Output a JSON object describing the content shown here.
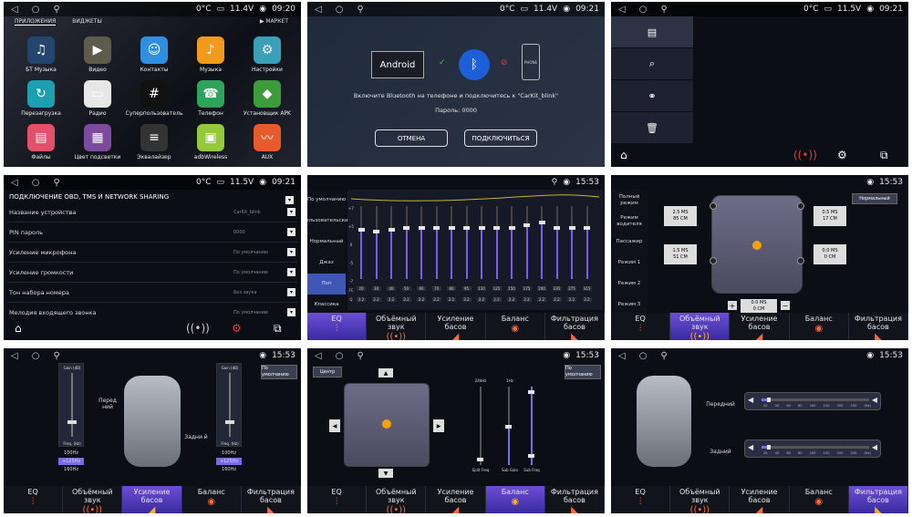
{
  "status": {
    "p1": {
      "temp": "0°C",
      "volt": "11.4V",
      "time": "09:20"
    },
    "p2": {
      "temp": "0°C",
      "volt": "11.4V",
      "time": "09:21"
    },
    "p3": {
      "temp": "0°C",
      "volt": "11.5V",
      "time": "09:21"
    },
    "p4": {
      "temp": "0°C",
      "volt": "11.5V",
      "time": "09:21"
    },
    "eq_time": "15:53"
  },
  "home": {
    "tab_apps": "ПРИЛОЖЕНИЯ",
    "tab_widgets": "ВИДЖЕТЫ",
    "market": "МАРКЕТ",
    "apps": [
      {
        "label": "БТ Музыка",
        "icon": "bluetooth-music-icon",
        "color": "#24466e",
        "glyph": "♫"
      },
      {
        "label": "Видео",
        "icon": "video-icon",
        "color": "#5d5c4c",
        "glyph": "▶"
      },
      {
        "label": "Контакты",
        "icon": "contacts-icon",
        "color": "#2f8fe0",
        "glyph": "☺"
      },
      {
        "label": "Музыка",
        "icon": "music-icon",
        "color": "#f29a1c",
        "glyph": "♪"
      },
      {
        "label": "Настройки",
        "icon": "settings-icon",
        "color": "#3aa0b8",
        "glyph": "⚙"
      },
      {
        "label": "Перезагрузка",
        "icon": "reload-icon",
        "color": "#1c9fb0",
        "glyph": "↻"
      },
      {
        "label": "Радио",
        "icon": "radio-icon",
        "color": "#e7e7e7",
        "glyph": "▭"
      },
      {
        "label": "Суперпользователь",
        "icon": "superuser-icon",
        "color": "#111111",
        "glyph": "#"
      },
      {
        "label": "Телефон",
        "icon": "phone-icon",
        "color": "#2ea35a",
        "glyph": "☎"
      },
      {
        "label": "Установщик APK",
        "icon": "apk-installer-icon",
        "color": "#3c9b3a",
        "glyph": "◆"
      },
      {
        "label": "Файлы",
        "icon": "files-icon",
        "color": "#e4506a",
        "glyph": "▤"
      },
      {
        "label": "Цвет подсветки",
        "icon": "backlight-color-icon",
        "color": "#7d4b9e",
        "glyph": "▦"
      },
      {
        "label": "Эквалайзер",
        "icon": "equalizer-icon",
        "color": "#333333",
        "glyph": "≡"
      },
      {
        "label": "adbWireless",
        "icon": "adb-wireless-icon",
        "color": "#93c93b",
        "glyph": "▣"
      },
      {
        "label": "AUX",
        "icon": "aux-icon",
        "color": "#e65a2b",
        "glyph": "〰"
      }
    ]
  },
  "bt": {
    "android": "Android",
    "phone": "PHONE",
    "message": "Включите Bluetooth на телефоне и подключитесь к \"CarKit_blink\"",
    "password": "Пароль: 0000",
    "cancel": "ОТМЕНА",
    "connect": "ПОДКЛЮЧИТЬСЯ"
  },
  "obd": {
    "title": "ПОДКЛЮЧЕНИЕ OBD, TMS И NETWORK SHARING",
    "rows": [
      {
        "label": "Название устройства",
        "value": "CarKit_blink"
      },
      {
        "label": "PIN пароль",
        "value": "0000"
      },
      {
        "label": "Усиление микрофона",
        "value": "По умолчанию"
      },
      {
        "label": "Усиление громкости",
        "value": "По умолчанию"
      },
      {
        "label": "Тон набора номера",
        "value": "Без звука"
      },
      {
        "label": "Мелодия входящего звонка",
        "value": "По умолчанию"
      }
    ]
  },
  "eq": {
    "presets": [
      "По умолчанию",
      "Пользовательские",
      "Нормальный",
      "Джаз",
      "Поп",
      "Классика",
      "Рок"
    ],
    "active_preset": "Поп",
    "bands": [
      "20",
      "30",
      "40",
      "50",
      "60",
      "70",
      "80",
      "95",
      "110",
      "125",
      "150",
      "175",
      "200",
      "235",
      "275",
      "315"
    ],
    "levels": [
      0.35,
      0.33,
      0.35,
      0.38,
      0.38,
      0.38,
      0.38,
      0.38,
      0.38,
      0.38,
      0.38,
      0.41,
      0.45,
      0.38,
      0.38,
      0.38
    ],
    "q": [
      "2.2",
      "2.2",
      "2.2",
      "2.2",
      "2.2",
      "2.2",
      "2.2",
      "2.2",
      "2.2",
      "2.2",
      "2.2",
      "2.2",
      "2.2",
      "2.2",
      "2.2",
      "2.2"
    ],
    "q_label": "Q",
    "fc_label": "FC",
    "axis": [
      "+7",
      "+5",
      "0",
      "-5",
      "-7"
    ]
  },
  "tabs": [
    "EQ",
    "Объёмный звук",
    "Усиление басов",
    "Баланс",
    "Фильтрация басов"
  ],
  "surround": {
    "modes": [
      "Полный режим",
      "Режим водителя",
      "Пассажир",
      "Режим 1",
      "Режим 2",
      "Режим 3"
    ],
    "normal": "Нормальный",
    "fl": [
      "2.5 MS",
      "85 CM"
    ],
    "fr": [
      "0.5 MS",
      "17 CM"
    ],
    "rl": [
      "1.5 MS",
      "51 CM"
    ],
    "rr": [
      "0.0 MS",
      "0 CM"
    ],
    "sub": [
      "0.0 MS",
      "0 CM"
    ]
  },
  "bass": {
    "front": "Перед ний",
    "rear": "Задни й",
    "default": "По умолчанию",
    "gain_label": "Gain (dB)",
    "freq_label": "Freq. (Hz)",
    "freqs": [
      "100Hz",
      "+125Hz",
      "160Hz"
    ]
  },
  "balance": {
    "center": "Центр",
    "default": "По умолчанию",
    "labels": [
      "24kHz",
      "1Hz",
      "Split Freq",
      "Sub Gain",
      "Sub Freq"
    ]
  },
  "filter": {
    "front": "Передний",
    "rear": "Задний",
    "ticks": [
      "20",
      "40",
      "60",
      "80",
      "100",
      "150",
      "200",
      "250",
      "(Hz)"
    ]
  }
}
